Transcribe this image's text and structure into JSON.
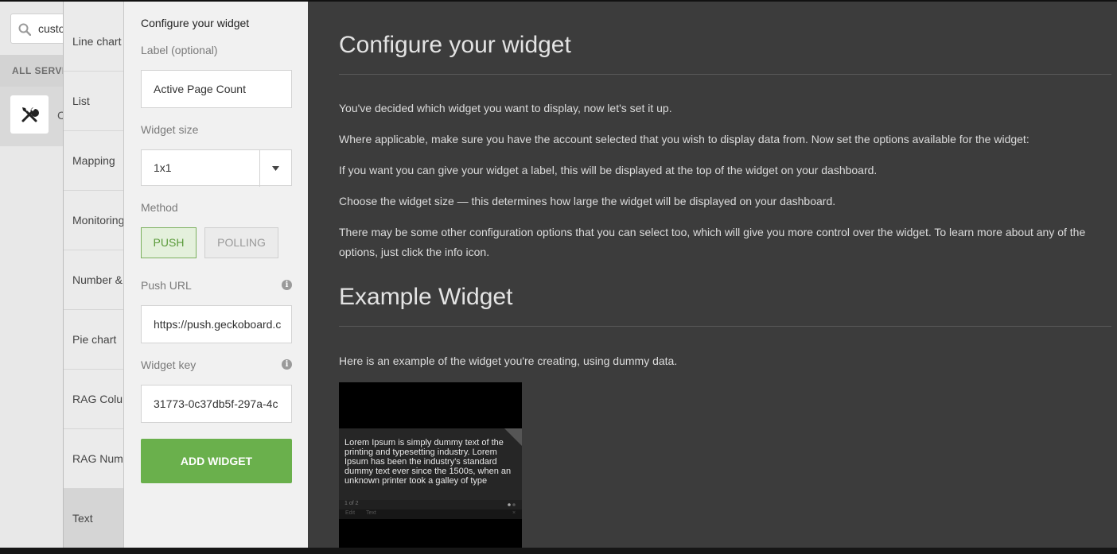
{
  "services": {
    "search_value": "custo",
    "all_services_label": "ALL SERVICES",
    "service_cut_text": "C"
  },
  "widget_types": [
    {
      "label": "Line chart"
    },
    {
      "label": "List"
    },
    {
      "label": "Mapping"
    },
    {
      "label": "Monitoring"
    },
    {
      "label": "Number & Secondary Stat"
    },
    {
      "label": "Pie chart"
    },
    {
      "label": "RAG Column & Numbers"
    },
    {
      "label": "RAG Numbers only"
    },
    {
      "label": "Text",
      "active": true
    }
  ],
  "config": {
    "title": "Configure your widget",
    "label_label": "Label (optional)",
    "label_value": "Active Page Count",
    "size_label": "Widget size",
    "size_value": "1x1",
    "method_label": "Method",
    "push_label": "PUSH",
    "polling_label": "POLLING",
    "push_url_label": "Push URL",
    "push_url_value": "https://push.geckoboard.com",
    "widget_key_label": "Widget key",
    "widget_key_value": "31773-0c37db5f-297a-4c",
    "info_glyph": "i",
    "add_button": "ADD WIDGET"
  },
  "help": {
    "title": "Configure your widget",
    "paragraphs": [
      "You've decided which widget you want to display, now let's set it up.",
      "Where applicable, make sure you have the account selected that you wish to display data from. Now set the options available for the widget:",
      "If you want you can give your widget a label, this will be displayed at the top of the widget on your dashboard.",
      "Choose the widget size — this determines how large the widget will be displayed on your dashboard.",
      "There may be some other configuration options that you can select too, which will give you more control over the widget. To learn more about any of the options, just click the info icon."
    ],
    "example_title": "Example Widget",
    "example_intro": "Here is an example of the widget you're creating, using dummy data.",
    "example_widget": {
      "text": "Lorem Ipsum is simply dummy text of the printing and typesetting industry. Lorem Ipsum has been the industry's standard dummy text ever since the 1500s, when an unknown printer took a galley of type",
      "pager": "1 of 2",
      "edit": "Edit",
      "type": "Text",
      "close": "×"
    }
  }
}
